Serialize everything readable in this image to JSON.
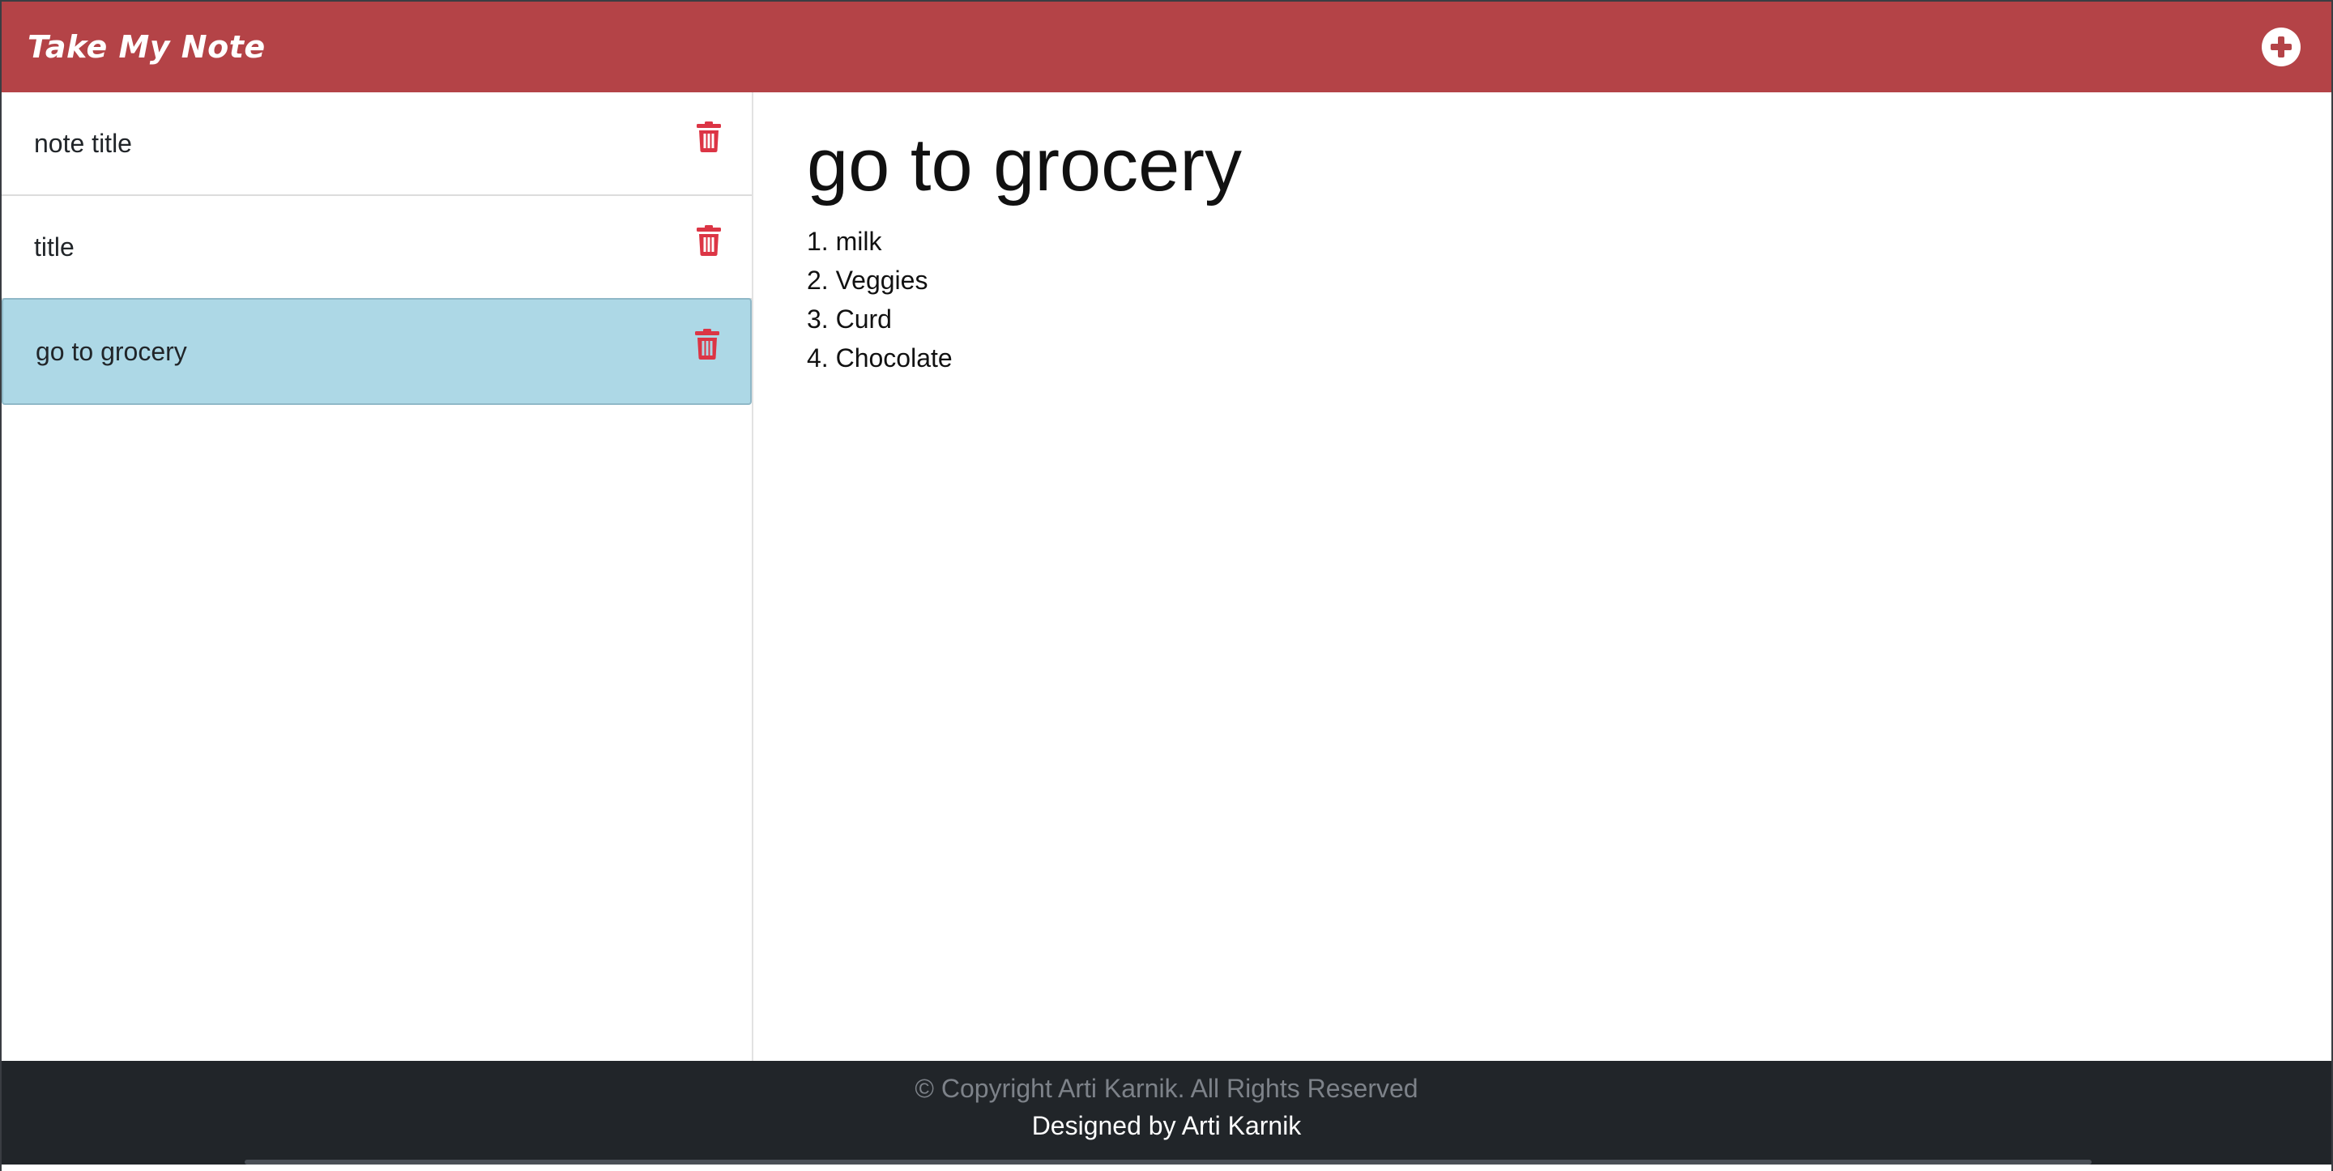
{
  "navbar": {
    "brand": "Take My Note",
    "add_icon": "plus-circle-icon",
    "brand_color": "#b44347"
  },
  "sidebar": {
    "notes": [
      {
        "title": "note title",
        "delete_icon": "trash-icon",
        "active": false
      },
      {
        "title": "title",
        "delete_icon": "trash-icon",
        "active": false
      },
      {
        "title": "go to grocery",
        "delete_icon": "trash-icon",
        "active": true
      }
    ],
    "active_color": "#add8e6",
    "delete_color": "#dc3545"
  },
  "main": {
    "title": "go to grocery",
    "lines": [
      "1. milk",
      "2. Veggies",
      "3. Curd",
      "4. Chocolate"
    ]
  },
  "footer": {
    "copyright": "© Copyright Arti Karnik. All Rights Reserved",
    "designed_by": "Designed by Arti Karnik"
  }
}
